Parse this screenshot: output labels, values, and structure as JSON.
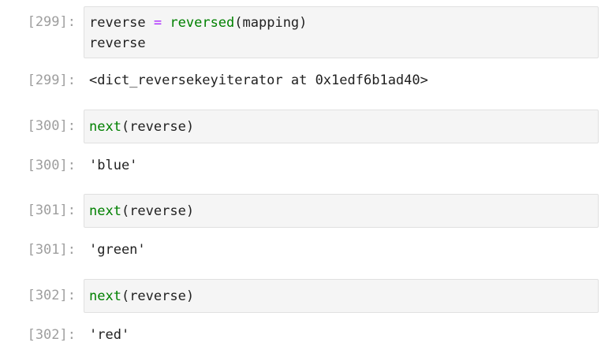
{
  "cells": [
    {
      "input_prompt": "[299]:",
      "input_lines": [
        [
          {
            "text": "reverse ",
            "kind": "name"
          },
          {
            "text": "=",
            "kind": "op"
          },
          {
            "text": " ",
            "kind": "name"
          },
          {
            "text": "reversed",
            "kind": "builtin"
          },
          {
            "text": "(mapping)",
            "kind": "paren"
          }
        ],
        [
          {
            "text": "reverse",
            "kind": "name"
          }
        ]
      ],
      "output_prompt": "[299]:",
      "output_text": "<dict_reversekeyiterator at 0x1edf6b1ad40>"
    },
    {
      "input_prompt": "[300]:",
      "input_lines": [
        [
          {
            "text": "next",
            "kind": "builtin"
          },
          {
            "text": "(reverse)",
            "kind": "paren"
          }
        ]
      ],
      "output_prompt": "[300]:",
      "output_text": "'blue'"
    },
    {
      "input_prompt": "[301]:",
      "input_lines": [
        [
          {
            "text": "next",
            "kind": "builtin"
          },
          {
            "text": "(reverse)",
            "kind": "paren"
          }
        ]
      ],
      "output_prompt": "[301]:",
      "output_text": "'green'"
    },
    {
      "input_prompt": "[302]:",
      "input_lines": [
        [
          {
            "text": "next",
            "kind": "builtin"
          },
          {
            "text": "(reverse)",
            "kind": "paren"
          }
        ]
      ],
      "output_prompt": "[302]:",
      "output_text": "'red'"
    }
  ],
  "colors": {
    "prompt": "#9e9e9e",
    "input_background": "#f5f5f5",
    "input_border": "#e0e0e0",
    "operator": "#aa22ff",
    "builtin": "#008000",
    "text": "#212121"
  }
}
